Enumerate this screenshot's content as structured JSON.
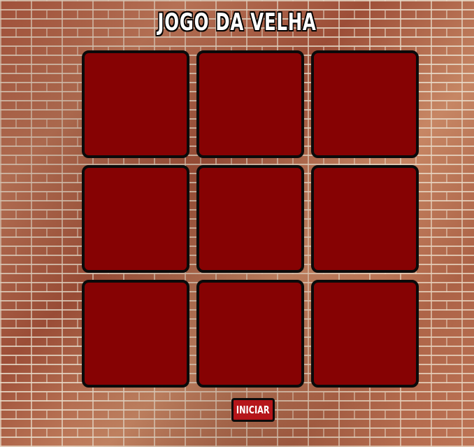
{
  "game": {
    "title": "JOGO DA VELHA",
    "board": {
      "rows": 3,
      "cols": 3,
      "cells": [
        "",
        "",
        "",
        "",
        "",
        "",
        "",
        "",
        ""
      ]
    },
    "start_label": "INICIAR"
  },
  "colors": {
    "cell_fill": "#860203",
    "cell_border": "#0a0a0a",
    "button_fill": "#b5161a",
    "title_text": "#ffffff"
  }
}
